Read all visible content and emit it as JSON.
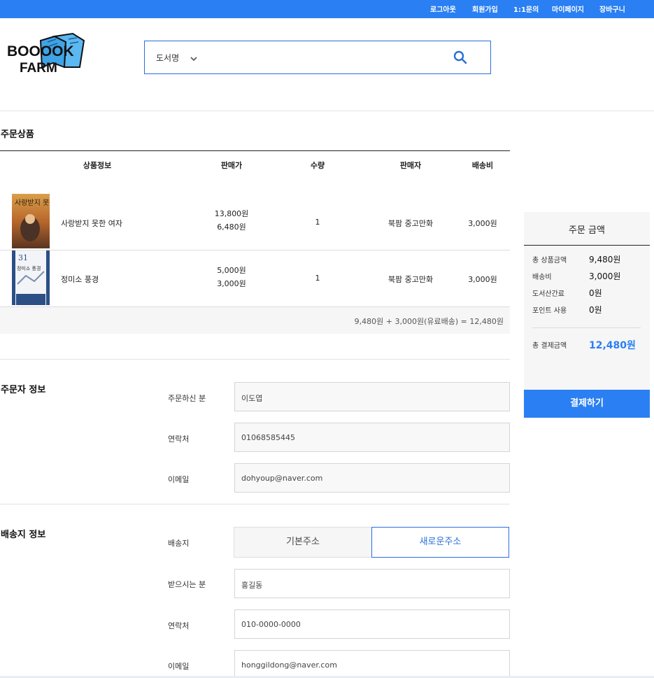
{
  "topnav": {
    "logout": "로그아웃",
    "signup": "회원가입",
    "inquiry": "1:1문의",
    "mypage": "마이페이지",
    "cart": "장바구니"
  },
  "logo": {
    "line1": "BOOOOK",
    "line2": "FARM"
  },
  "search": {
    "category": "도서명"
  },
  "order_items": {
    "title": "주문상품",
    "headers": {
      "info": "상품정보",
      "price": "판매가",
      "qty": "수량",
      "seller": "판매자",
      "shipping": "배송비"
    },
    "rows": [
      {
        "title": "사랑받지 못한 여자",
        "list_price": "13,800원",
        "sale_price": "6,480원",
        "qty": "1",
        "seller": "북팜 중고만화",
        "shipping": "3,000원",
        "cover_text": "사랑받지 못한 여자"
      },
      {
        "title": "정미소 풍경",
        "list_price": "5,000원",
        "sale_price": "3,000원",
        "qty": "1",
        "seller": "북팜 중고만화",
        "shipping": "3,000원",
        "cover_text": "정미소 풍경"
      }
    ],
    "total_line": "9,480원 + 3,000원(유료배송) = 12,480원"
  },
  "orderer": {
    "title": "주문자 정보",
    "name_label": "주문하신 분",
    "name": "이도엽",
    "phone_label": "연락처",
    "phone": "01068585445",
    "email_label": "이메일",
    "email": "dohyoup@naver.com"
  },
  "delivery": {
    "title": "배송지 정보",
    "address_label": "배송지",
    "tab_default": "기본주소",
    "tab_new": "새로운주소",
    "receiver_label": "받으시는 분",
    "receiver": "홍길동",
    "phone_label": "연락처",
    "phone": "010-0000-0000",
    "email_label": "이메일",
    "email": "honggildong@naver.com"
  },
  "summary": {
    "title": "주문 금액",
    "items_label": "총 상품금액",
    "items": "9,480원",
    "shipping_label": "배송비",
    "shipping": "3,000원",
    "island_label": "도서산간료",
    "island": "0원",
    "points_label": "포인트 사용",
    "points": "0원",
    "total_label": "총 결제금액",
    "total": "12,480원",
    "pay_button": "결제하기"
  },
  "colors": {
    "accent": "#2a7ff3",
    "border_accent": "#2a6fdc"
  }
}
